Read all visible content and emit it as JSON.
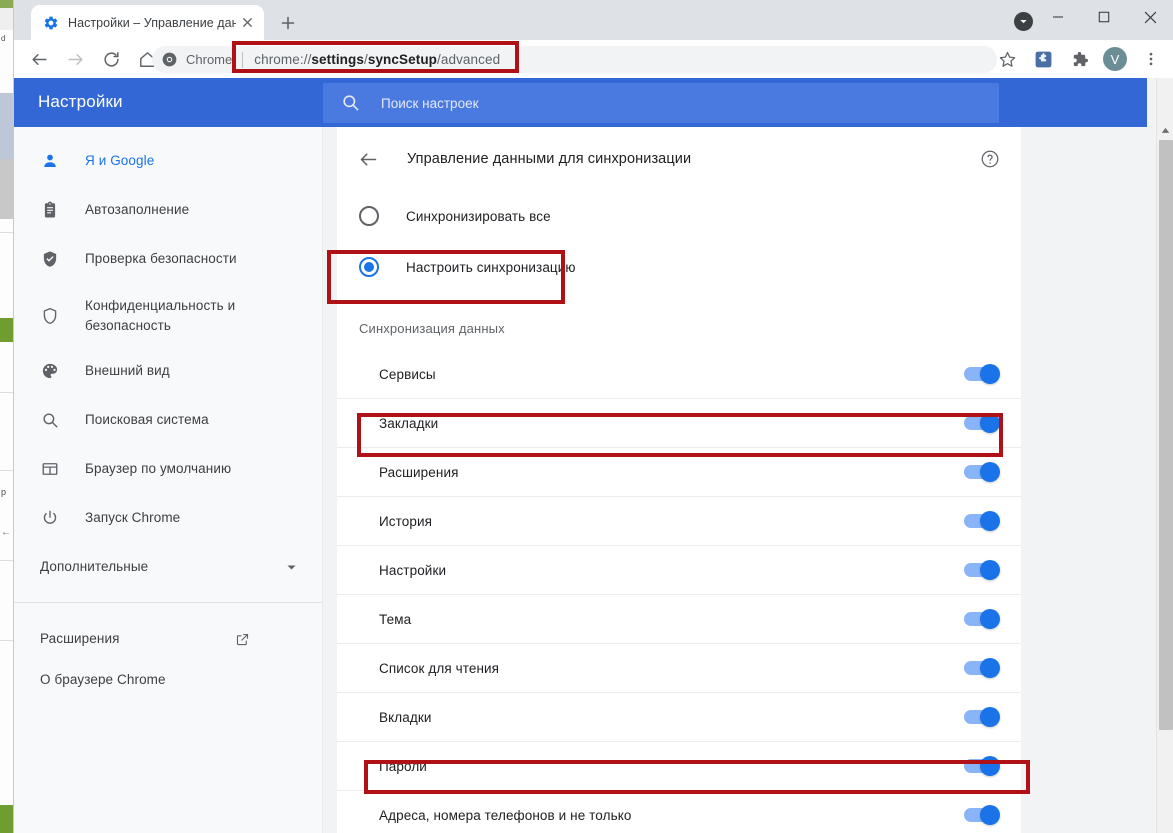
{
  "browser": {
    "tab": {
      "title": "Настройки – Управление данны",
      "favicon_icon": "gear-icon",
      "close_icon": "close-icon"
    },
    "newtab_icon": "plus-icon",
    "caret_badge_icon": "caret-down-icon",
    "window_controls": {
      "minimize": "minimize-icon",
      "maximize": "maximize-icon",
      "close": "window-close-icon"
    },
    "toolbar": {
      "back_icon": "arrow-left-icon",
      "forward_icon": "arrow-right-icon",
      "reload_icon": "reload-icon",
      "home_icon": "home-icon",
      "omnibox": {
        "chip_icon": "chrome-logo-icon",
        "chip_label": "Chrome",
        "url_prefix": "chrome://",
        "url_bold1": "settings",
        "url_mid": "/",
        "url_bold2": "syncSetup",
        "url_suffix": "/advanced",
        "url_full": "chrome://settings/syncSetup/advanced"
      },
      "bookmark_icon": "star-icon",
      "sync_extension_icon": "puzzle-blue-icon",
      "extensions_icon": "puzzle-icon",
      "profile_initial": "V",
      "menu_icon": "three-dots-icon"
    }
  },
  "settings": {
    "header": {
      "title": "Настройки",
      "search_icon": "search-icon",
      "search_placeholder": "Поиск настроек"
    },
    "sidebar": {
      "items": [
        {
          "label": "Я и Google",
          "icon": "person-icon",
          "active": true
        },
        {
          "label": "Автозаполнение",
          "icon": "clipboard-icon",
          "active": false
        },
        {
          "label": "Проверка безопасности",
          "icon": "shield-check-icon",
          "active": false
        },
        {
          "label": "Конфиденциальность и",
          "label2": "безопасность",
          "icon": "shield-icon",
          "active": false
        },
        {
          "label": "Внешний вид",
          "icon": "palette-icon",
          "active": false
        },
        {
          "label": "Поисковая система",
          "icon": "search-icon",
          "active": false
        },
        {
          "label": "Браузер по умолчанию",
          "icon": "browser-window-icon",
          "active": false
        },
        {
          "label": "Запуск Chrome",
          "icon": "power-icon",
          "active": false
        }
      ],
      "advanced": {
        "label": "Дополнительные",
        "icon": "chevron-down-icon"
      },
      "footer": [
        {
          "label": "Расширения",
          "icon": "open-in-new-icon"
        },
        {
          "label": "О браузере Chrome",
          "icon": ""
        }
      ]
    },
    "main": {
      "back_icon": "arrow-left-icon",
      "page_title": "Управление данными для синхронизации",
      "help_icon": "help-circle-icon",
      "radios": [
        {
          "label": "Синхронизировать все",
          "checked": false
        },
        {
          "label": "Настроить синхронизацию",
          "checked": true
        }
      ],
      "section_title": "Синхронизация данных",
      "toggles": [
        {
          "label": "Сервисы",
          "on": true
        },
        {
          "label": "Закладки",
          "on": true
        },
        {
          "label": "Расширения",
          "on": true
        },
        {
          "label": "История",
          "on": true
        },
        {
          "label": "Настройки",
          "on": true
        },
        {
          "label": "Тема",
          "on": true
        },
        {
          "label": "Список для чтения",
          "on": true
        },
        {
          "label": "Вкладки",
          "on": true
        },
        {
          "label": "Пароли",
          "on": true
        },
        {
          "label": "Адреса, номера телефонов и не только",
          "on": true
        }
      ]
    },
    "scrollbar": {
      "arrow_up_icon": "triangle-up-icon"
    }
  },
  "annotations": {
    "highlight_color": "#b01116",
    "boxes": [
      {
        "name": "url-highlight",
        "target": "chrome://settings/syncSetup/advanced"
      },
      {
        "name": "configure-sync-highlight",
        "target": "Настроить синхронизацию"
      },
      {
        "name": "bookmarks-row-highlight",
        "target": "Закладки"
      },
      {
        "name": "passwords-row-highlight",
        "target": "Пароли"
      }
    ]
  },
  "colors": {
    "chrome_blue": "#3367d6",
    "accent_blue": "#1a73e8",
    "toggle_track": "#8ab4f8",
    "sidebar_bg": "#f8f9fa",
    "page_bg": "#f1f3f4"
  }
}
